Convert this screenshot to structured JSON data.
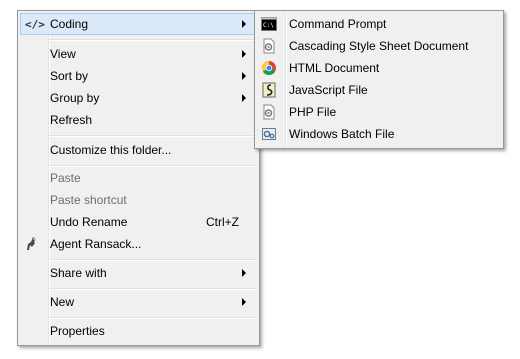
{
  "main_menu": {
    "coding": "Coding",
    "view": "View",
    "sort_by": "Sort by",
    "group_by": "Group by",
    "refresh": "Refresh",
    "customize": "Customize this folder...",
    "paste": "Paste",
    "paste_shortcut": "Paste shortcut",
    "undo_rename": "Undo Rename",
    "undo_rename_shortcut": "Ctrl+Z",
    "agent_ransack": "Agent Ransack...",
    "share_with": "Share with",
    "new": "New",
    "properties": "Properties",
    "coding_icon_text": "</>"
  },
  "coding_submenu": {
    "command_prompt": "Command Prompt",
    "css_document": "Cascading Style Sheet Document",
    "html_document": "HTML Document",
    "javascript_file": "JavaScript File",
    "php_file": "PHP File",
    "batch_file": "Windows Batch File"
  },
  "colors": {
    "highlight": "#dbe9fa",
    "highlight_border": "#a8cdf4",
    "disabled_text": "#6d6d6d"
  }
}
